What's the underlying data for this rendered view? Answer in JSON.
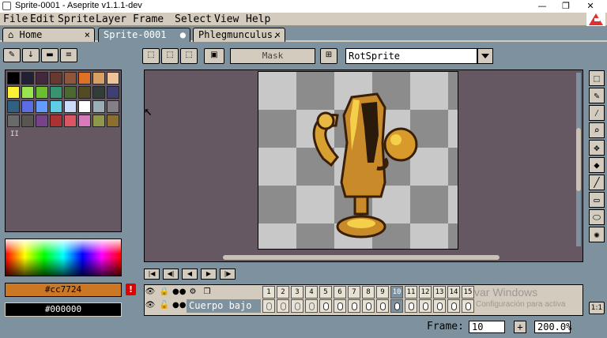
{
  "window": {
    "title": "Sprite-0001 - Aseprite v1.1.1-dev",
    "min": "—",
    "max": "❐",
    "close": "✕"
  },
  "menu": [
    "File",
    "Edit",
    "Sprite",
    "Layer",
    "Frame",
    "Select",
    "View",
    "Help"
  ],
  "tabs": [
    {
      "label": "Home",
      "close": "×"
    },
    {
      "label": "Sprite-0001",
      "close": "●"
    },
    {
      "label": "Phlegmunculus.",
      "close": "×"
    }
  ],
  "toolbar": {
    "mask_label": "Mask",
    "rotation_algorithm": "RotSprite"
  },
  "palette": {
    "label": "II",
    "colors": [
      "#000000",
      "#222034",
      "#45283c",
      "#663931",
      "#8f563b",
      "#df7126",
      "#d9a066",
      "#eec39a",
      "#fbf236",
      "#99e550",
      "#6abe30",
      "#37946e",
      "#4b692f",
      "#524b24",
      "#323c39",
      "#3f3f74",
      "#306082",
      "#5b6ee1",
      "#639bff",
      "#5fcde4",
      "#cbdbfc",
      "#ffffff",
      "#9badb7",
      "#847e87",
      "#696a6a",
      "#595652",
      "#76428a",
      "#ac3232",
      "#d95763",
      "#d77bba",
      "#8f974a",
      "#8a6f30"
    ]
  },
  "colors": {
    "foreground": "#cc7724",
    "background": "#000000",
    "warning": "!"
  },
  "tools": [
    "marquee-icon",
    "pencil-icon",
    "eyedropper-icon",
    "zoom-icon",
    "move-icon",
    "fill-icon",
    "line-icon",
    "rectangle-icon",
    "ellipse-icon",
    "blur-icon"
  ],
  "timeline": {
    "nav": [
      "|◀",
      "◀|",
      "◀",
      "▶",
      "|▶",
      "▶|"
    ],
    "layer_name": "Cuerpo bajo",
    "frames": [
      "1",
      "2",
      "3",
      "4",
      "5",
      "6",
      "7",
      "8",
      "9",
      "10",
      "11",
      "12",
      "13",
      "14",
      "15"
    ],
    "current_frame_index": 9,
    "empty_cels": 4,
    "watermark_title": "var Windows",
    "watermark_sub": "Configuración para activa"
  },
  "status": {
    "frame_label": "Frame:",
    "frame_value": "10",
    "plus": "+",
    "zoom": "200.0%",
    "onion": "1:1"
  }
}
